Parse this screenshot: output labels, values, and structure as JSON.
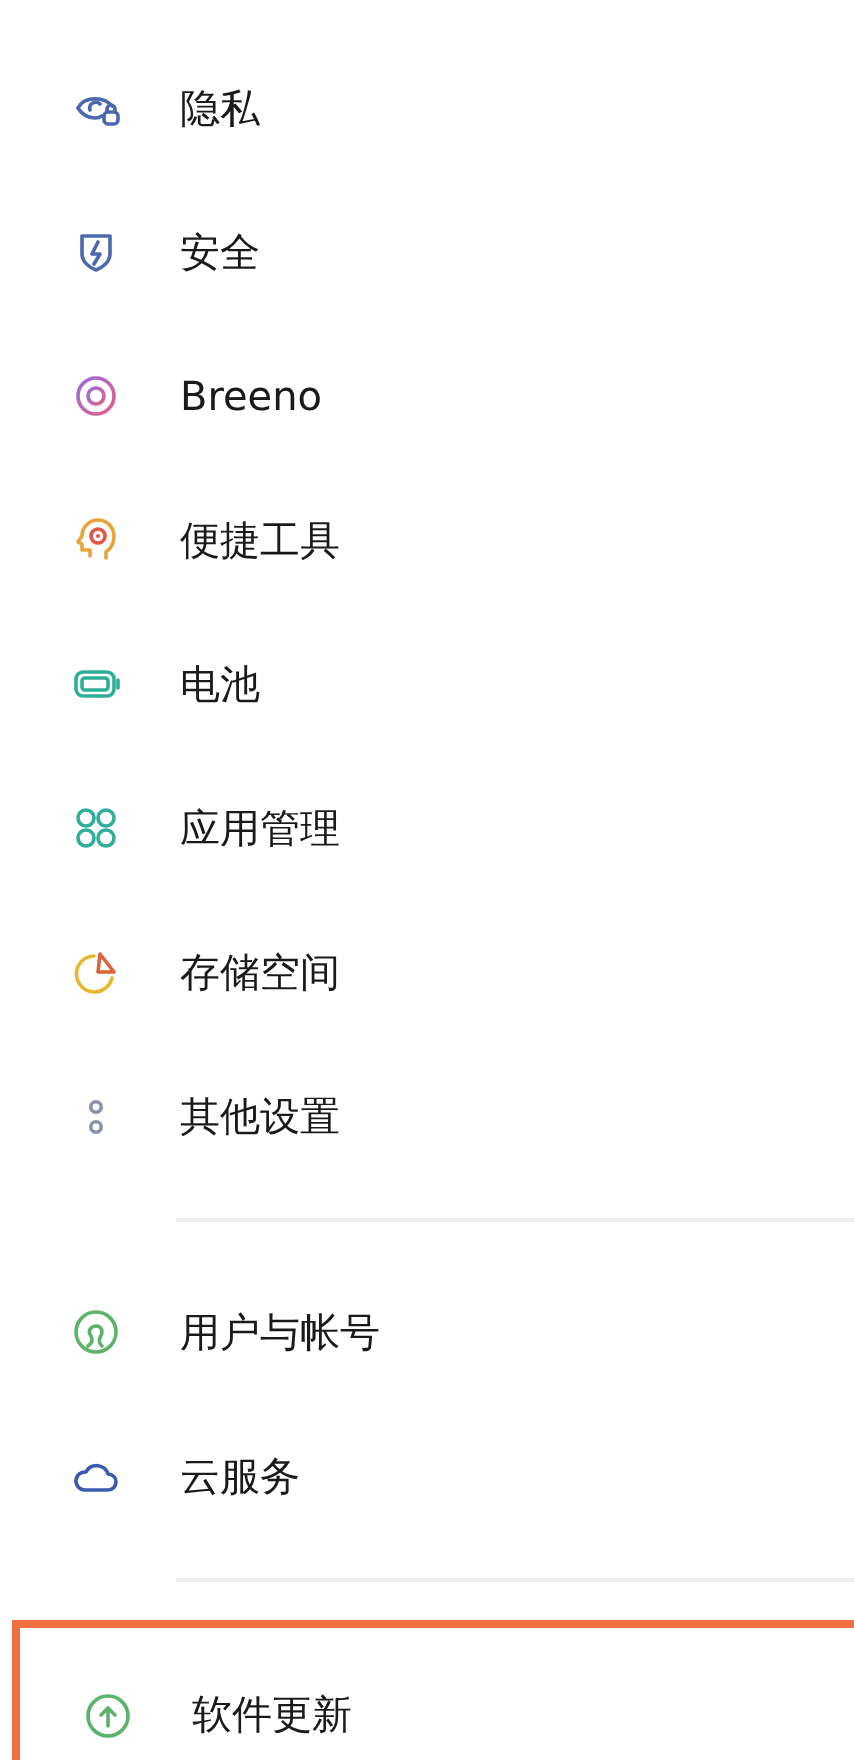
{
  "groups": [
    {
      "items": [
        {
          "label": "隐私",
          "highlighted": false
        },
        {
          "label": "安全",
          "highlighted": false
        },
        {
          "label": "Breeno",
          "highlighted": false
        },
        {
          "label": "便捷工具",
          "highlighted": false
        },
        {
          "label": "电池",
          "highlighted": false
        },
        {
          "label": "应用管理",
          "highlighted": false
        },
        {
          "label": "存储空间",
          "highlighted": false
        },
        {
          "label": "其他设置",
          "highlighted": false
        }
      ]
    },
    {
      "items": [
        {
          "label": "用户与帐号",
          "highlighted": false
        },
        {
          "label": "云服务",
          "highlighted": false
        }
      ]
    },
    {
      "items": [
        {
          "label": "软件更新",
          "highlighted": true
        }
      ]
    }
  ]
}
